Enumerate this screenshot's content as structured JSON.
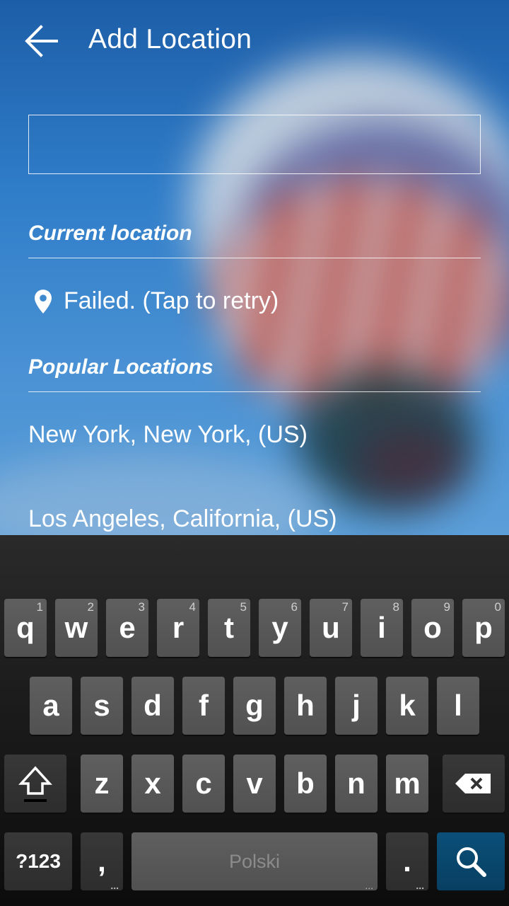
{
  "header": {
    "title": "Add Location"
  },
  "search": {
    "value": "",
    "placeholder": ""
  },
  "current_location": {
    "heading": "Current location",
    "status": "Failed. (Tap to retry)"
  },
  "popular": {
    "heading": "Popular Locations",
    "items": [
      "New York, New York, (US)",
      "Los Angeles, California, (US)"
    ]
  },
  "keyboard": {
    "row1": [
      {
        "key": "q",
        "hint": "1"
      },
      {
        "key": "w",
        "hint": "2"
      },
      {
        "key": "e",
        "hint": "3"
      },
      {
        "key": "r",
        "hint": "4"
      },
      {
        "key": "t",
        "hint": "5"
      },
      {
        "key": "y",
        "hint": "6"
      },
      {
        "key": "u",
        "hint": "7"
      },
      {
        "key": "i",
        "hint": "8"
      },
      {
        "key": "o",
        "hint": "9"
      },
      {
        "key": "p",
        "hint": "0"
      }
    ],
    "row2": [
      "a",
      "s",
      "d",
      "f",
      "g",
      "h",
      "j",
      "k",
      "l"
    ],
    "row3": [
      "z",
      "x",
      "c",
      "v",
      "b",
      "n",
      "m"
    ],
    "symbols_label": "?123",
    "comma_label": ",",
    "space_label": "Polski",
    "period_label": ".",
    "colors": {
      "search_key": "#0b4f78",
      "key": "#5a5a5a",
      "background": "#1d1d1d"
    }
  }
}
